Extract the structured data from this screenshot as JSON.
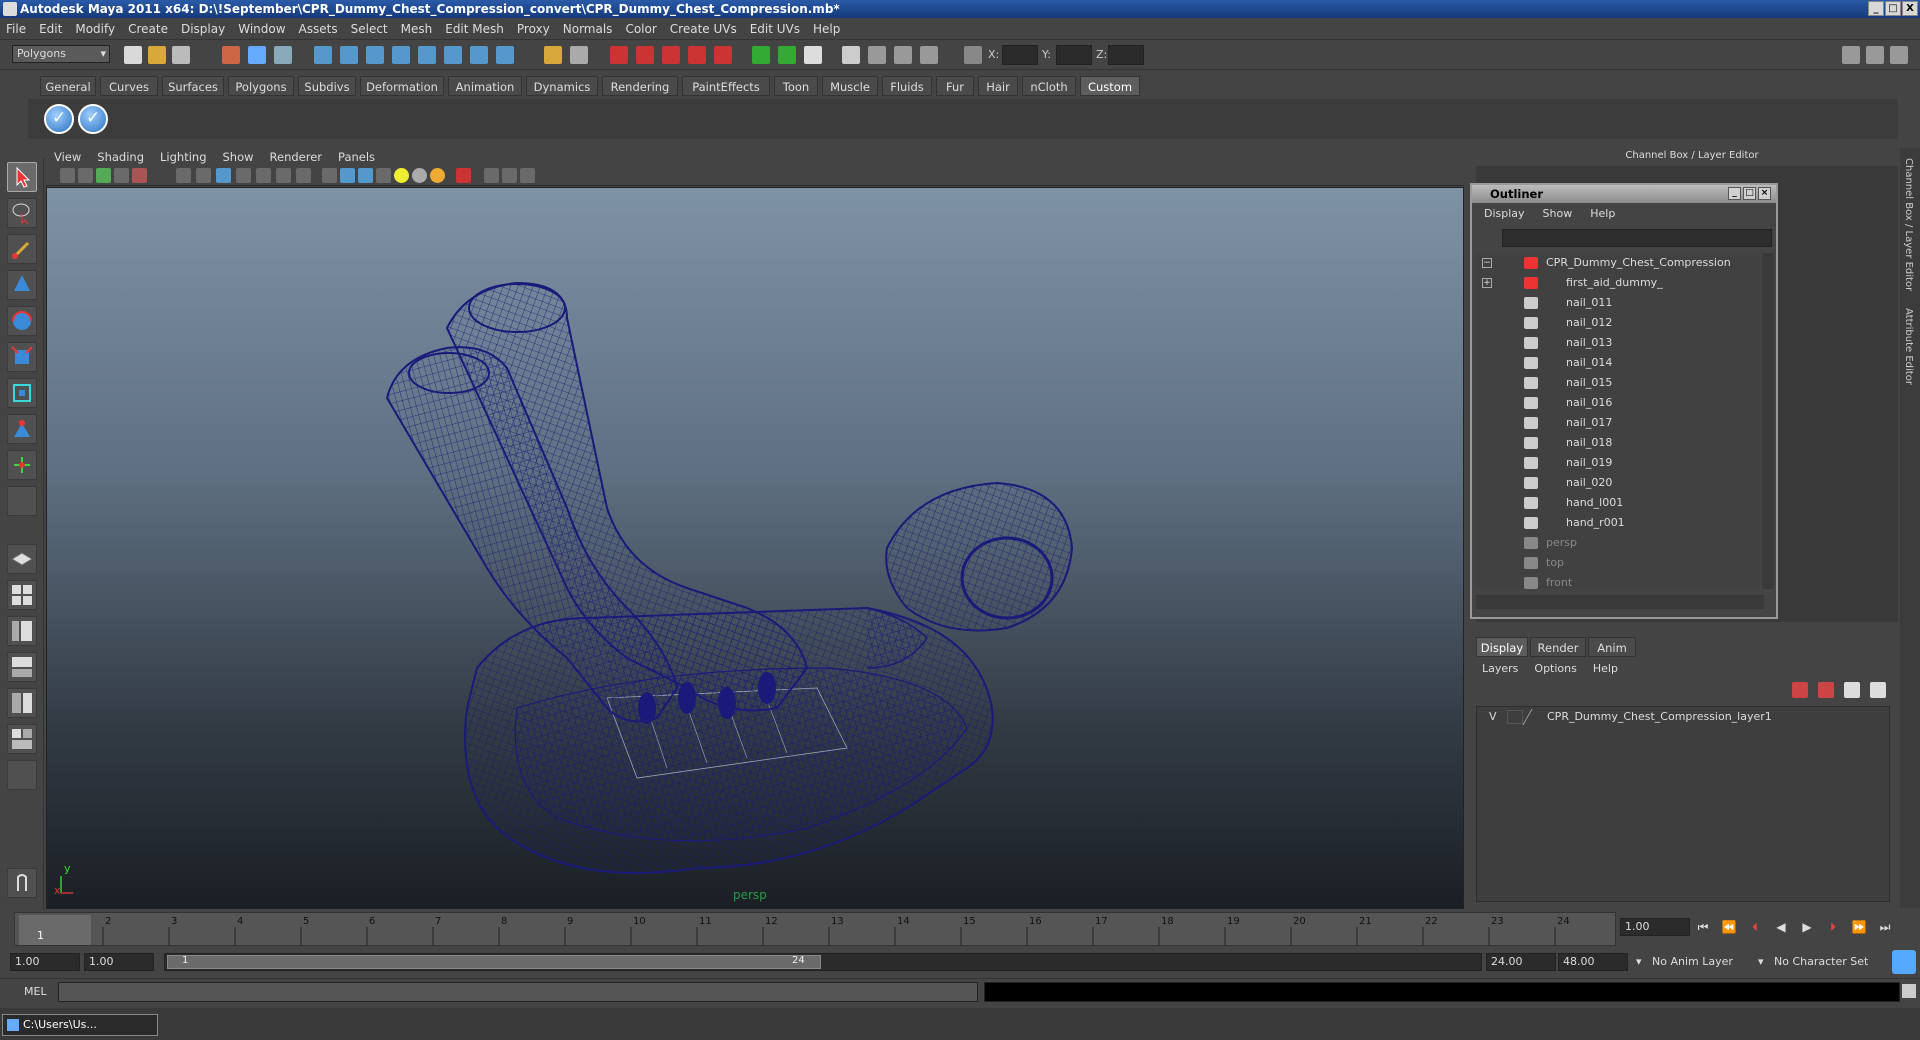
{
  "window": {
    "title": "Autodesk Maya 2011 x64: D:\\!September\\CPR_Dummy_Chest_Compression_convert\\CPR_Dummy_Chest_Compression.mb*",
    "controls": [
      "_",
      "□",
      "X"
    ]
  },
  "menubar": [
    "File",
    "Edit",
    "Modify",
    "Create",
    "Display",
    "Window",
    "Assets",
    "Select",
    "Mesh",
    "Edit Mesh",
    "Proxy",
    "Normals",
    "Color",
    "Create UVs",
    "Edit UVs",
    "Help"
  ],
  "statusline": {
    "mode": "Polygons",
    "x_label": "X:",
    "y_label": "Y:",
    "z_label": "Z:"
  },
  "shelf": {
    "tabs": [
      "General",
      "Curves",
      "Surfaces",
      "Polygons",
      "Subdivs",
      "Deformation",
      "Animation",
      "Dynamics",
      "Rendering",
      "PaintEffects",
      "Toon",
      "Muscle",
      "Fluids",
      "Fur",
      "Hair",
      "nCloth",
      "Custom"
    ],
    "active_tab": "Custom"
  },
  "viewport": {
    "menu": [
      "View",
      "Shading",
      "Lighting",
      "Show",
      "Renderer",
      "Panels"
    ],
    "camera_label": "persp",
    "axis_x": "x",
    "axis_y": "y",
    "wire_color": "#1a1a7a"
  },
  "right_panel": {
    "header": "Channel Box / Layer Editor",
    "side_tabs": [
      "Channel Box / Layer Editor",
      "Attribute Editor"
    ]
  },
  "outliner": {
    "title": "Outliner",
    "menu": [
      "Display",
      "Show",
      "Help"
    ],
    "items": [
      {
        "label": "CPR_Dummy_Chest_Compression",
        "expander": "−",
        "dim": false
      },
      {
        "label": "first_aid_dummy_",
        "expander": "+",
        "dim": false
      },
      {
        "label": "nail_011",
        "dim": false
      },
      {
        "label": "nail_012",
        "dim": false
      },
      {
        "label": "nail_013",
        "dim": false
      },
      {
        "label": "nail_014",
        "dim": false
      },
      {
        "label": "nail_015",
        "dim": false
      },
      {
        "label": "nail_016",
        "dim": false
      },
      {
        "label": "nail_017",
        "dim": false
      },
      {
        "label": "nail_018",
        "dim": false
      },
      {
        "label": "nail_019",
        "dim": false
      },
      {
        "label": "nail_020",
        "dim": false
      },
      {
        "label": "hand_l001",
        "dim": false
      },
      {
        "label": "hand_r001",
        "dim": false
      },
      {
        "label": "persp",
        "dim": true
      },
      {
        "label": "top",
        "dim": true
      },
      {
        "label": "front",
        "dim": true
      }
    ]
  },
  "layer_editor": {
    "tabs": [
      "Display",
      "Render",
      "Anim"
    ],
    "active_tab": "Display",
    "menu": [
      "Layers",
      "Options",
      "Help"
    ],
    "layers": [
      {
        "visible": "V",
        "name": "CPR_Dummy_Chest_Compression_layer1"
      }
    ]
  },
  "timeline": {
    "ticks": [
      "1",
      "2",
      "3",
      "4",
      "5",
      "6",
      "7",
      "8",
      "9",
      "10",
      "11",
      "12",
      "13",
      "14",
      "15",
      "16",
      "17",
      "18",
      "19",
      "20",
      "21",
      "22",
      "23",
      "24"
    ],
    "current_frame_marker": "1",
    "current_time": "1.00",
    "range_start": "1.00",
    "playback_start": "1.00",
    "slider_start": "1",
    "slider_end": "24",
    "playback_end": "24.00",
    "range_end": "48.00",
    "anim_layer": "No Anim Layer",
    "character_set": "No Character Set"
  },
  "command_line": {
    "label": "MEL"
  },
  "taskbar": {
    "item": "C:\\Users\\Us..."
  }
}
